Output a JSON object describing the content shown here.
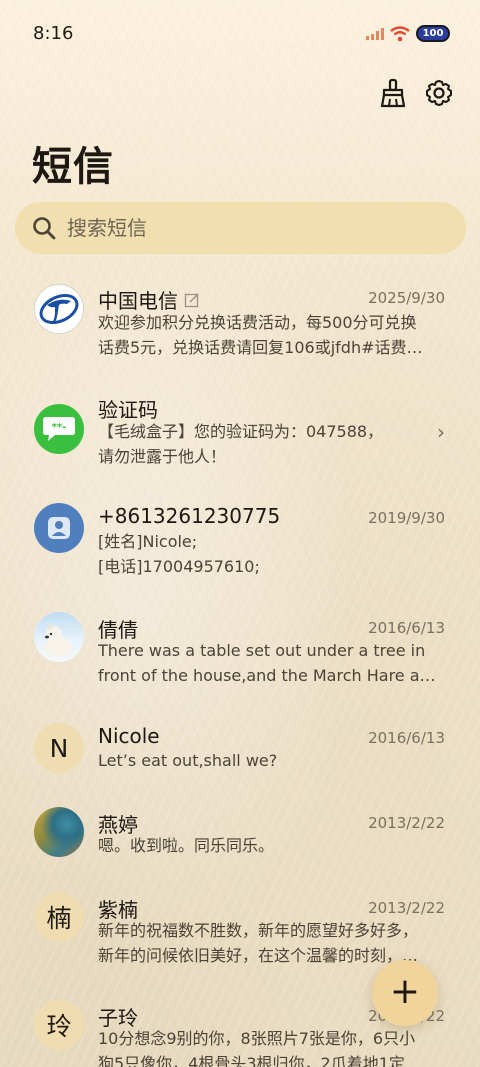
{
  "status_bar": {
    "time": "8:16",
    "battery": "100"
  },
  "header": {
    "title": "短信"
  },
  "top_actions": {
    "clean_icon": "broom-icon",
    "settings_icon": "gear-icon"
  },
  "search": {
    "placeholder": "搜索短信",
    "value": ""
  },
  "conversations": [
    {
      "name": "中国电信",
      "date": "2025/9/30",
      "line1": "欢迎参加积分兑换话费活动，每500分可兑换",
      "line2": "话费5元，兑换话费请回复106或jfdh#话费…",
      "avatar": "china-telecom-logo"
    },
    {
      "name": "验证码",
      "date": "",
      "line1": "【毛绒盒子】您的验证码为：047588，",
      "line2": "请勿泄露于他人！",
      "avatar": "message-bubble-icon"
    },
    {
      "name": "+8613261230775",
      "date": "2019/9/30",
      "line1": "[姓名]Nicole;",
      "line2": "[电话]17004957610;",
      "avatar": "person-icon"
    },
    {
      "name": "倩倩",
      "date": "2016/6/13",
      "line1": "There was a table set out under a tree in",
      "line2": "front of the house,and the March Hare an…",
      "avatar": "polar-bear-photo"
    },
    {
      "name": "Nicole",
      "date": "2016/6/13",
      "line1": "Let’s eat out,shall we?",
      "line2": "",
      "avatar_letter": "N"
    },
    {
      "name": "燕婷",
      "date": "2013/2/22",
      "line1": "嗯。收到啦。同乐同乐。",
      "line2": "",
      "avatar": "landscape-photo"
    },
    {
      "name": "紫楠",
      "date": "2013/2/22",
      "line1": "新年的祝福数不胜数，新年的愿望好多好多，",
      "line2": "新年的问候依旧美好，在这个温馨的时刻，…",
      "avatar_letter": "楠"
    },
    {
      "name": "子玲",
      "date": "2013/2/22",
      "line1": "10分想念9别的你，8张照片7张是你，6只小",
      "line2": "狗5只像你，4根骨头3根归你，2爪着地1定…",
      "avatar_letter": "玲"
    }
  ],
  "fab": {
    "label": "+"
  }
}
